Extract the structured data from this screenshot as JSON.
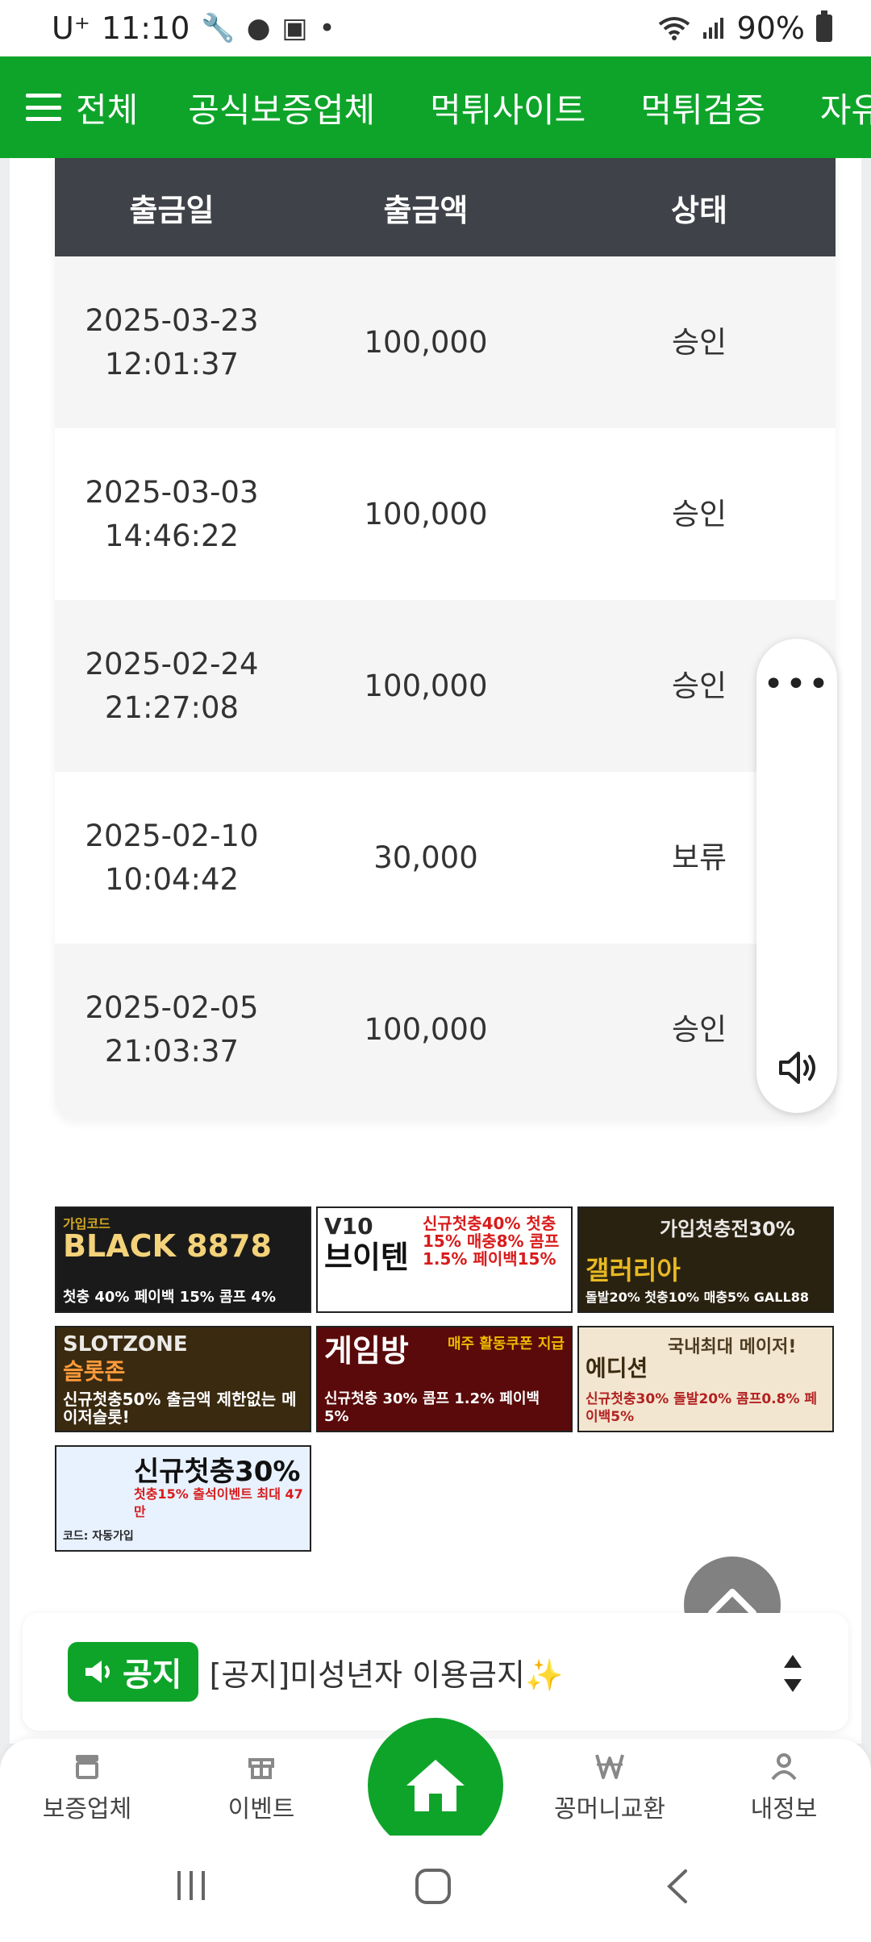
{
  "status_bar": {
    "carrier": "U⁺",
    "time": "11:10",
    "battery": "90%"
  },
  "top_nav": {
    "menu_label": "전체",
    "items": [
      "공식보증업체",
      "먹튀사이트",
      "먹튀검증",
      "자유"
    ]
  },
  "table": {
    "headers": [
      "출금일",
      "출금액",
      "상태"
    ],
    "rows": [
      {
        "date": "2025-03-23",
        "time": "12:01:37",
        "amount": "100,000",
        "status": "승인"
      },
      {
        "date": "2025-03-03",
        "time": "14:46:22",
        "amount": "100,000",
        "status": "승인"
      },
      {
        "date": "2025-02-24",
        "time": "21:27:08",
        "amount": "100,000",
        "status": "승인"
      },
      {
        "date": "2025-02-10",
        "time": "10:04:42",
        "amount": "30,000",
        "status": "보류"
      },
      {
        "date": "2025-02-05",
        "time": "21:03:37",
        "amount": "100,000",
        "status": "승인"
      }
    ]
  },
  "side_panel": {
    "more_icon": "more-dots-icon",
    "speaker_icon": "speaker-icon"
  },
  "banners": [
    {
      "tag": "가입코드",
      "big": "BLACK 8878",
      "sub": "첫충 40% 페이백 15% 콤프 4%",
      "color": "#1a1a1a",
      "accent": "#e8b923"
    },
    {
      "tag": "V10",
      "big": "브이텐",
      "sub": "신규첫충40% 첫충15% 매충8% 콤프1.5% 페이백15%",
      "color": "#ffffff",
      "accent": "#d81b1b"
    },
    {
      "tag": "가입첫충전30%",
      "big": "갤러리아",
      "sub": "돌발20% 첫충10% 매충5% GALL88",
      "color": "#2a2210",
      "accent": "#e8b923"
    },
    {
      "tag": "SLOTZONE",
      "big": "슬롯존",
      "sub": "신규첫충50% 출금액 제한없는 메이저슬롯!",
      "color": "#3a2a10",
      "accent": "#ff3b30"
    },
    {
      "tag": "매주 활동쿠폰 지급",
      "big": "게임방",
      "sub": "신규첫충 30% 콤프 1.2% 페이백 5%",
      "color": "#5a0a0a",
      "accent": "#ffcc00"
    },
    {
      "tag": "국내최대 메이저!",
      "big": "에디션",
      "sub": "신규첫충30% 돌발20% 콤프0.8% 페이백5%",
      "color": "#f3e6d0",
      "accent": "#b22222"
    },
    {
      "tag": "코드: 자동가입",
      "big": "신규첫충30%",
      "sub": "첫충15% 출석이벤트 최대 47만",
      "color": "#e8f2ff",
      "accent": "#d81b1b"
    }
  ],
  "notice": {
    "badge": "공지",
    "text": "[공지]미성년자 이용금지✨"
  },
  "bottom_nav": {
    "items": [
      {
        "label": "보증업체",
        "icon": "store-icon"
      },
      {
        "label": "이벤트",
        "icon": "gift-icon"
      },
      {
        "label": "꽁머니교환",
        "icon": "won-icon"
      },
      {
        "label": "내정보",
        "icon": "person-icon"
      }
    ],
    "home_icon": "home-icon"
  },
  "colors": {
    "brand_green": "#0ea42a",
    "table_header": "#3f4248"
  }
}
